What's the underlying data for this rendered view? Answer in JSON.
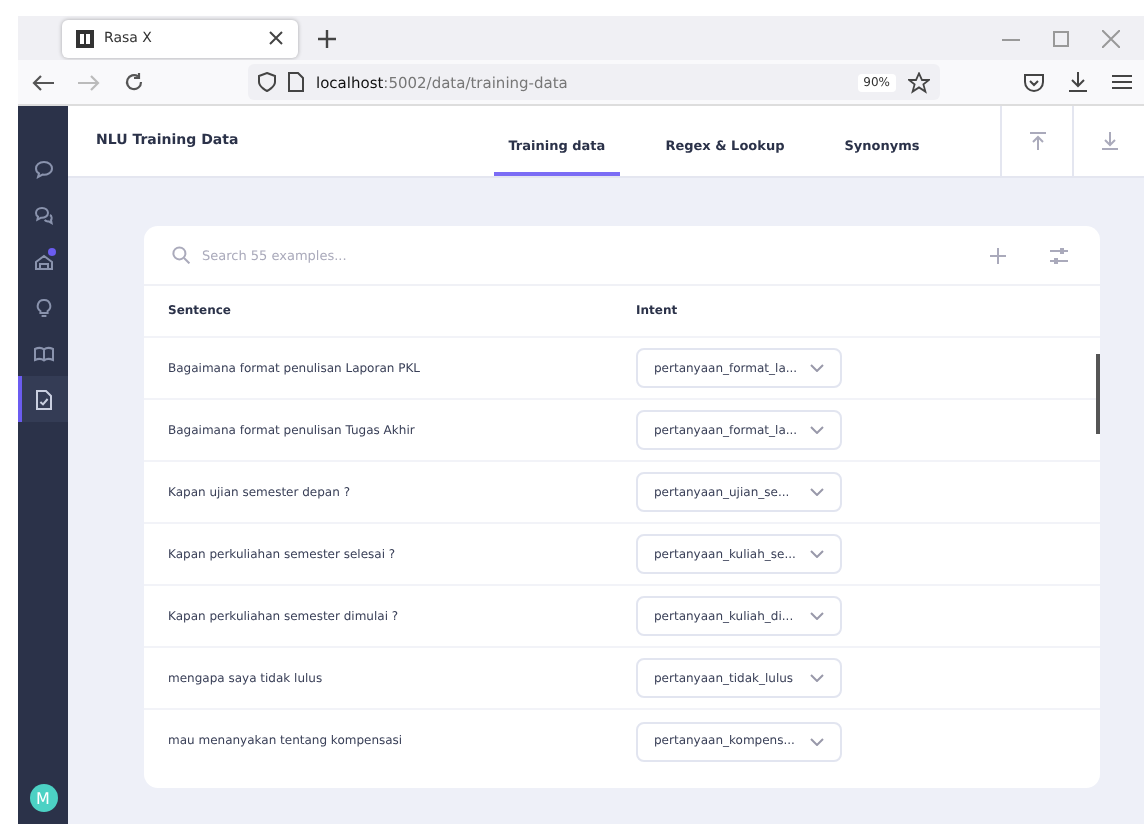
{
  "browser": {
    "tab_title": "Rasa X",
    "url_host": "localhost",
    "url_path": ":5002/data/training-data",
    "zoom": "90%"
  },
  "sidebar": {
    "items": [
      {
        "kind": "chat",
        "selected": false,
        "badge": false
      },
      {
        "kind": "chats",
        "selected": false,
        "badge": false
      },
      {
        "kind": "models",
        "selected": false,
        "badge": true
      },
      {
        "kind": "bulb",
        "selected": false,
        "badge": false
      },
      {
        "kind": "book",
        "selected": false,
        "badge": false
      },
      {
        "kind": "file",
        "selected": true,
        "badge": false
      }
    ],
    "avatar": "M"
  },
  "header": {
    "title": "NLU Training Data",
    "tabs": [
      {
        "label": "Training data",
        "selected": true
      },
      {
        "label": "Regex & Lookup",
        "selected": false
      },
      {
        "label": "Synonyms",
        "selected": false
      }
    ]
  },
  "search": {
    "placeholder": "Search 55 examples..."
  },
  "table": {
    "columns": [
      "Sentence",
      "Intent"
    ],
    "rows": [
      {
        "sentence": "Bagaimana format penulisan Laporan PKL",
        "intent": "pertanyaan_format_la..."
      },
      {
        "sentence": "Bagaimana format penulisan Tugas Akhir",
        "intent": "pertanyaan_format_la..."
      },
      {
        "sentence": "Kapan ujian semester depan ?",
        "intent": "pertanyaan_ujian_se..."
      },
      {
        "sentence": "Kapan perkuliahan semester selesai ?",
        "intent": "pertanyaan_kuliah_se..."
      },
      {
        "sentence": "Kapan perkuliahan semester dimulai ?",
        "intent": "pertanyaan_kuliah_di..."
      },
      {
        "sentence": "mengapa saya tidak lulus",
        "intent": "pertanyaan_tidak_lulus"
      },
      {
        "sentence": "mau menanyakan tentang kompensasi",
        "intent": "pertanyaan_kompens..."
      }
    ]
  }
}
